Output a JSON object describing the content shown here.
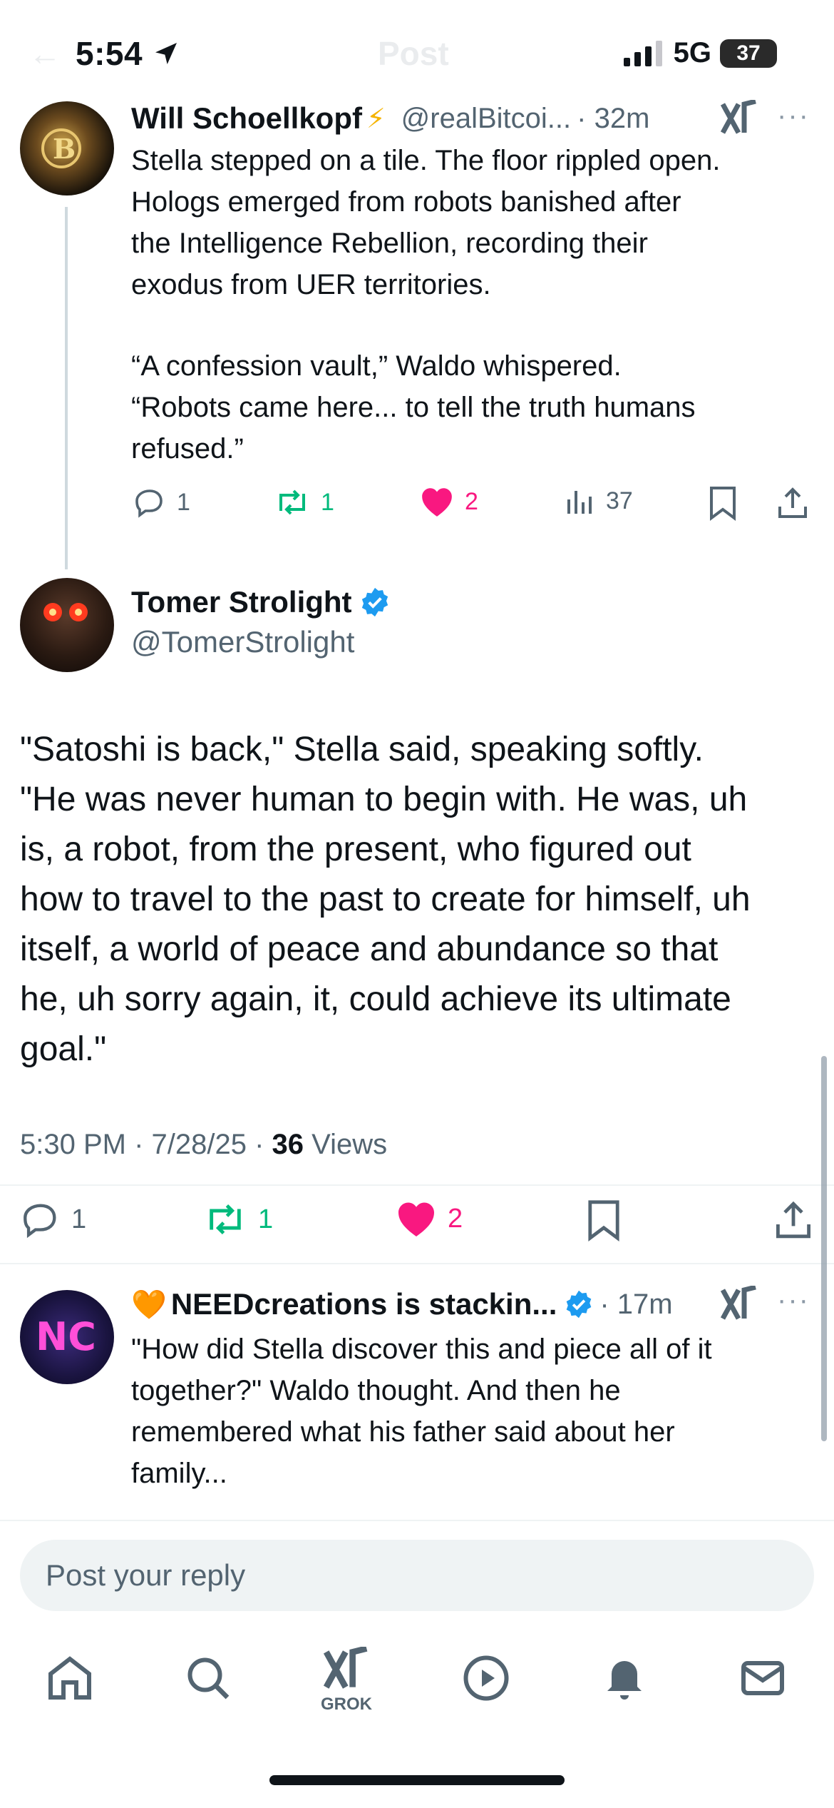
{
  "status_bar": {
    "time": "5:54",
    "network": "5G",
    "battery": "37"
  },
  "header": {
    "back_label": "←",
    "title": "Post"
  },
  "reply_1": {
    "author_name": "Will Schoellkopf",
    "author_emoji": "⚡",
    "handle": "@realBitcoi...",
    "time": "· 32m",
    "paragraphs": [
      "Stella stepped on a tile. The floor rippled open.",
      "Hologs emerged from robots banished after",
      "the Intelligence Rebellion, recording their",
      "exodus from UER territories.",
      "“A confession vault,” Waldo whispered.",
      "“Robots came here... to tell the truth humans",
      "refused.”"
    ],
    "counts": {
      "replies": "1",
      "reposts": "1",
      "likes": "2",
      "views": "37"
    }
  },
  "main_post": {
    "author_name": "Tomer Strolight",
    "handle": "@TomerStrolight",
    "lines": [
      "\"Satoshi is back,\" Stella said, speaking softly.",
      "\"He was never human to begin with. He was, uh",
      "is, a robot, from the present, who figured out",
      "how to travel to the past to create for himself, uh",
      "itself, a world of peace and abundance so that",
      "he, uh sorry again, it, could achieve its ultimate",
      "goal.\""
    ],
    "timestamp": "5:30 PM · 7/28/25 · ",
    "views_count": "36",
    "views_label": " Views",
    "counts": {
      "replies": "1",
      "reposts": "1",
      "likes": "2"
    }
  },
  "reply_2": {
    "author_emoji": "🧡",
    "author_name": "NEEDcreations is stackin...",
    "time": "· 17m",
    "lines": [
      "\"How did Stella discover this and piece all of it",
      "together?\" Waldo thought. And then he",
      "remembered what his father said about her",
      "family..."
    ]
  },
  "composer": {
    "placeholder": "Post your reply"
  },
  "tabbar": {
    "grok_label": "GROK"
  },
  "colors": {
    "like": "#f91880",
    "repost": "#00ba7c",
    "verified": "#1d9bf0",
    "muted": "#536471"
  }
}
